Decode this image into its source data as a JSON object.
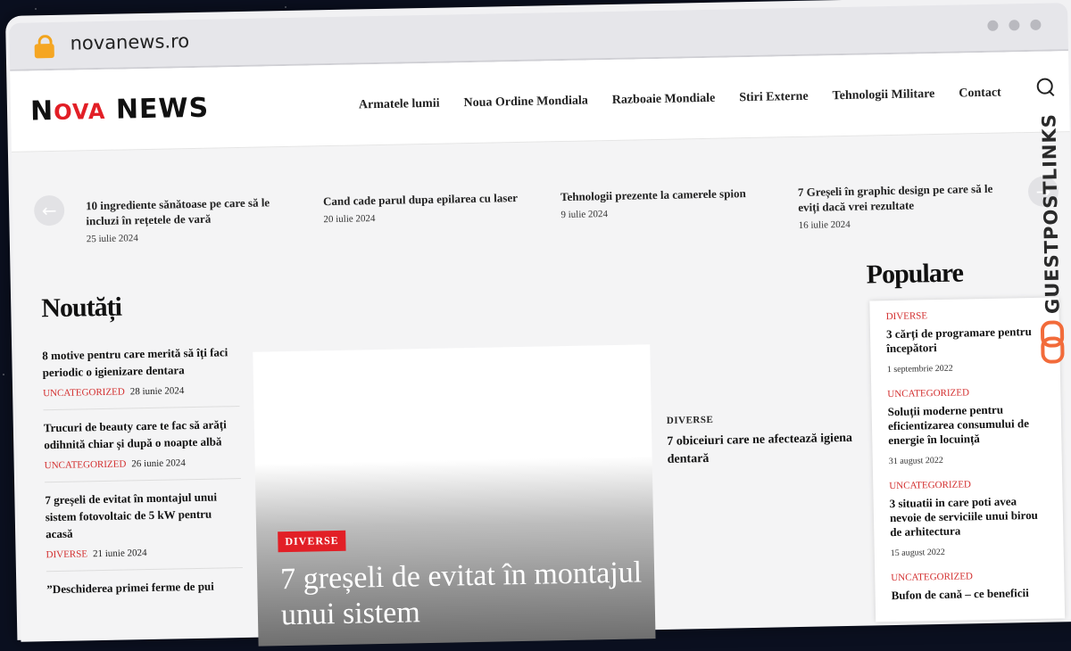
{
  "browser": {
    "url": "novanews.ro"
  },
  "logo": {
    "n": "N",
    "ova": "OVA",
    "news": "NEWS"
  },
  "nav": [
    "Armatele lumii",
    "Noua Ordine Mondiala",
    "Razboaie Mondiale",
    "Stiri Externe",
    "Tehnologii Militare",
    "Contact"
  ],
  "ticker": [
    {
      "title": "10 ingrediente sănătoase pe care să le incluzi în rețetele de vară",
      "date": "25 iulie 2024"
    },
    {
      "title": "Cand cade parul dupa epilarea cu laser",
      "date": "20 iulie 2024"
    },
    {
      "title": "Tehnologii prezente la camerele spion",
      "date": "9 iulie 2024"
    },
    {
      "title": "7 Greșeli în graphic design pe care să le eviți dacă vrei rezultate",
      "date": "16 iulie 2024"
    }
  ],
  "sections": {
    "news": "Noutăți",
    "popular": "Populare"
  },
  "news": [
    {
      "title": "8 motive pentru care merită să îți faci periodic o igienizare dentara",
      "category": "Uncategorized",
      "date": "28 iunie 2024"
    },
    {
      "title": "Trucuri de beauty care te fac să arăți odihnită chiar și după o noapte albă",
      "category": "Uncategorized",
      "date": "26 iunie 2024"
    },
    {
      "title": "7 greșeli de evitat în montajul unui sistem fotovoltaic de 5 kW pentru acasă",
      "category": "Diverse",
      "date": "21 iunie 2024"
    },
    {
      "title": "”Deschiderea primei ferme de pui",
      "category": "",
      "date": ""
    }
  ],
  "feature": {
    "category": "DIVERSE",
    "title": "7 greșeli de evitat în montajul unui sistem"
  },
  "mid": {
    "category": "DIVERSE",
    "title": "7 obiceiuri care ne afectează igiena dentară"
  },
  "popular": [
    {
      "category": "Diverse",
      "title": "3 cărți de programare pentru începători",
      "date": "1 septembrie 2022"
    },
    {
      "category": "Uncategorized",
      "title": "Soluții moderne pentru eficientizarea consumului de energie în locuință",
      "date": "31 august 2022"
    },
    {
      "category": "Uncategorized",
      "title": "3 situatii in care poti avea nevoie de serviciile unui birou de arhitectura",
      "date": "15 august 2022"
    },
    {
      "category": "Uncategorized",
      "title": "Bufon de cană – ce beneficii",
      "date": ""
    }
  ],
  "watermark": "GUESTPOSTLINKS",
  "colors": {
    "accent": "#e21f26",
    "category": "#d32f2f",
    "watermark_icon": "#f26b3a"
  },
  "icons": [
    "lock-icon",
    "search-icon",
    "arrow-left-icon",
    "arrow-right-icon",
    "chain-link-icon"
  ]
}
